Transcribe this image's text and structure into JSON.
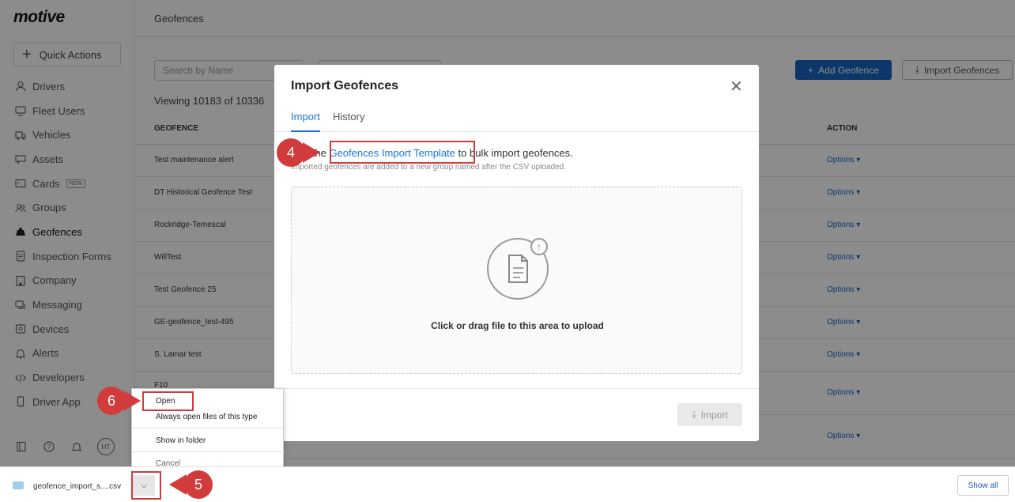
{
  "app": {
    "logo": "motive",
    "quick_actions": "Quick Actions",
    "page_title": "Geofences"
  },
  "sidebar": {
    "items": [
      {
        "label": "Drivers",
        "icon": "person-icon"
      },
      {
        "label": "Fleet Users",
        "icon": "monitor-icon"
      },
      {
        "label": "Vehicles",
        "icon": "truck-icon"
      },
      {
        "label": "Assets",
        "icon": "trailer-icon"
      },
      {
        "label": "Cards",
        "icon": "card-icon",
        "badge": "NEW"
      },
      {
        "label": "Groups",
        "icon": "groups-icon"
      },
      {
        "label": "Geofences",
        "icon": "geofence-icon"
      },
      {
        "label": "Inspection Forms",
        "icon": "document-icon"
      },
      {
        "label": "Company",
        "icon": "building-icon"
      },
      {
        "label": "Messaging",
        "icon": "chat-icon"
      },
      {
        "label": "Devices",
        "icon": "device-icon"
      },
      {
        "label": "Alerts",
        "icon": "bell-icon"
      },
      {
        "label": "Developers",
        "icon": "code-icon"
      },
      {
        "label": "Driver App",
        "icon": "phone-icon"
      }
    ],
    "avatar": "HT"
  },
  "toolbar": {
    "search_placeholder": "Search by Name",
    "add_label": "Add Geofence",
    "import_label": "Import Geofences",
    "viewing": "Viewing 10183 of 10336"
  },
  "table": {
    "headers": [
      "GEOFENCE",
      "ACTION"
    ],
    "option_label": "Options",
    "rows": [
      "Test maintenance alert",
      "DT Historical Geofence Test",
      "Rockridge-Temescal",
      "WillTest",
      "Test Geofence 25",
      "GE-geofence_test-495",
      "S. Lamar test",
      "F10",
      ""
    ]
  },
  "modal": {
    "title": "Import Geofences",
    "tabs": [
      "Import",
      "History"
    ],
    "instr_before": "Use the",
    "instr_link": "Geofences Import Template",
    "instr_after": "to bulk import geofences.",
    "sub_instr": "Imported geofences are added to a new group named after the CSV uploaded.",
    "drop_text": "Click or drag file to this area to upload",
    "import_button": "Import"
  },
  "callouts": {
    "c4": "4",
    "c5": "5",
    "c6": "6"
  },
  "context_menu": {
    "items": [
      "Open",
      "Always open files of this type",
      "Show in folder",
      "Cancel"
    ]
  },
  "download_bar": {
    "filename": "geofence_import_s....csv",
    "show_all": "Show all"
  },
  "colors": {
    "primary": "#1565c0",
    "link": "#1976d2",
    "callout": "#d23b3b"
  }
}
